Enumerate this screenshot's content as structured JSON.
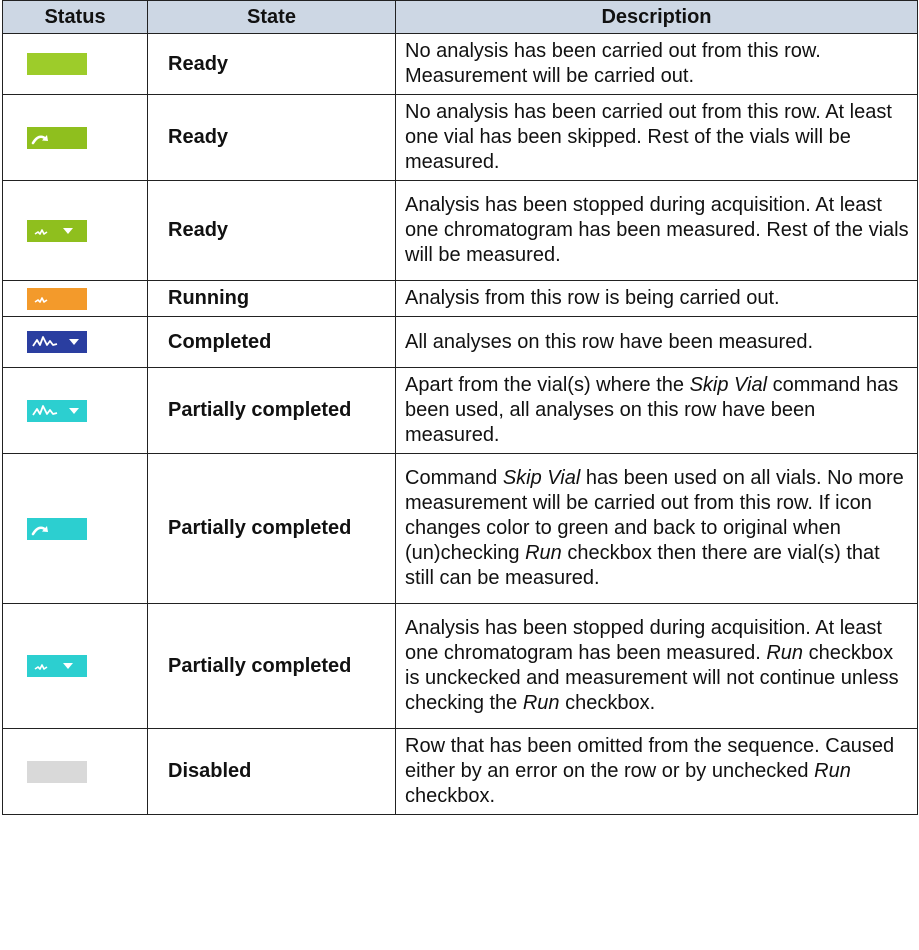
{
  "headers": {
    "status": "Status",
    "state": "State",
    "description": "Description"
  },
  "rows": [
    {
      "color": "#9dcc2a",
      "icon": "none",
      "state": "Ready",
      "desc": [
        "No analysis has been carried out from this row. Measurement will be carried out."
      ]
    },
    {
      "color": "#8fbf1e",
      "icon": "skip-arrow-icon",
      "state": "Ready",
      "desc": [
        "No analysis has been carried out from this row. At least one vial has been skipped. Rest of the vials will be measured."
      ]
    },
    {
      "color": "#8fbf1e",
      "icon": "chromatogram-small-dropdown-icon",
      "state": "Ready",
      "desc": [
        "Analysis has been stopped during acquisition. At least one chromatogram has been measured. Rest of the vials will be measured."
      ]
    },
    {
      "color": "#f39a2b",
      "icon": "chromatogram-small-icon",
      "state": "Running",
      "desc": [
        "Analysis from this row is being carried out."
      ]
    },
    {
      "color": "#2a3ea0",
      "icon": "chromatogram-dropdown-icon",
      "state": "Completed",
      "desc": [
        "All analyses on this row have been measured."
      ]
    },
    {
      "color": "#2ccfd0",
      "icon": "chromatogram-dropdown-icon",
      "state": "Partially completed",
      "desc": [
        "Apart from the vial(s) where the ",
        "Skip Vial",
        " command has been used, all analyses on this row have been measured."
      ]
    },
    {
      "color": "#2ccfd0",
      "icon": "skip-arrow-icon",
      "state": "Partially completed",
      "desc": [
        "Command ",
        "Skip Vial",
        " has been used on all vials. No more measurement will be carried out from this row. If icon changes color to green and back to original when (un)checking ",
        "Run",
        " checkbox then there are vial(s) that still can be measured."
      ]
    },
    {
      "color": "#2ccfd0",
      "icon": "chromatogram-small-dropdown-icon",
      "state": "Partially completed",
      "desc": [
        "Analysis has been stopped during acquisition. At least one chromatogram has been measured. ",
        "Run",
        " checkbox is unckecked and measurement will not continue unless checking the ",
        "Run",
        " checkbox."
      ]
    },
    {
      "color": "#d9d9d9",
      "icon": "none",
      "state": "Disabled",
      "desc": [
        "Row that has been omitted from the sequence. Caused either by an error on the row or by unchecked ",
        "Run",
        " checkbox."
      ]
    }
  ]
}
